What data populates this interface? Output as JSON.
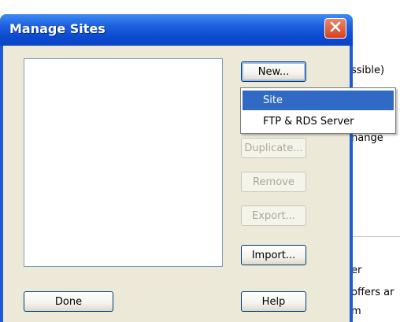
{
  "dialog": {
    "title": "Manage Sites"
  },
  "buttons": {
    "new": "New...",
    "duplicate": "Duplicate...",
    "remove": "Remove",
    "export": "Export...",
    "import": "Import...",
    "done": "Done",
    "help": "Help"
  },
  "new_menu": {
    "items": [
      "Site",
      "FTP & RDS Server"
    ],
    "selected": "Site"
  },
  "background_window": {
    "fragments": [
      "ssible)",
      "nange",
      "er",
      "offers ar",
      "m"
    ]
  },
  "colors": {
    "titlebar": "#0a49cf",
    "close_button": "#d6411c",
    "dialog_body": "#ece9d8",
    "menu_highlight": "#316ac5"
  },
  "icons": {
    "close": "close-x-icon"
  }
}
